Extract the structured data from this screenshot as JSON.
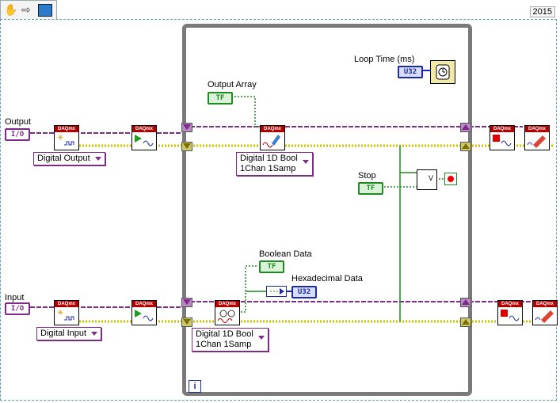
{
  "year_tag": "2015",
  "toolbar": {
    "hand_icon": "hand-icon",
    "arrow_icon": "arrow-right-icon",
    "vi_icon": "labview-vi-icon"
  },
  "output": {
    "label": "Output",
    "terminal": "I/O",
    "task_ring": "Digital Output"
  },
  "input": {
    "label": "Input",
    "terminal": "I/O",
    "task_ring": "Digital Input"
  },
  "loop_time": {
    "label": "Loop Time (ms)",
    "terminal": "U32"
  },
  "output_array": {
    "label": "Output Array",
    "terminal": "TF"
  },
  "stop": {
    "label": "Stop",
    "terminal": "TF",
    "or_symbol": "V"
  },
  "write_ring": {
    "line1": "Digital 1D Bool",
    "line2": "1Chan 1Samp"
  },
  "read_ring": {
    "line1": "Digital 1D Bool",
    "line2": "1Chan 1Samp"
  },
  "boolean_data": {
    "label": "Boolean Data",
    "terminal": "TF"
  },
  "hex_data": {
    "label": "Hexadecimal Data",
    "terminal": "U32"
  },
  "daqmx_tag": "DAQmx",
  "loop_iteration": "i",
  "colors": {
    "boolean_wire": "#1f8a1f",
    "task_wire": "#7d2b86",
    "error_wire": "#c8c000",
    "numeric_wire": "#1c2aa8"
  }
}
